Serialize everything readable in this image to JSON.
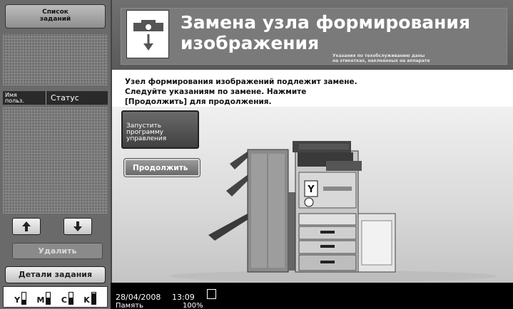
{
  "left_panel": {
    "job_list_button": "Список\nзаданий",
    "col_user": "Имя\nпольз.",
    "col_status": "Статус",
    "delete_button": "Удалить",
    "details_button": "Детали задания",
    "toner": [
      {
        "label": "Y",
        "level": 0.35
      },
      {
        "label": "M",
        "level": 0.55
      },
      {
        "label": "C",
        "level": 0.55
      },
      {
        "label": "K",
        "level": 0.95
      }
    ]
  },
  "main": {
    "title": "Замена узла формирования\nизображения",
    "title_note": "Указания по техобслуживанию даны\nна этикетках, наклеенных на аппарате",
    "instruction": "Узел формирования изображений подлежит замене.\nСледуйте указаниям по замене. Нажмите\n[Продолжить] для продолжения.",
    "program_button": "Запустить\nпрограмму\nуправления",
    "continue_button": "Продолжить",
    "unit_marker": "Y"
  },
  "status_bar": {
    "date": "28/04/2008",
    "time": "13:09",
    "memory_label": "Память",
    "memory_value": "100%"
  }
}
